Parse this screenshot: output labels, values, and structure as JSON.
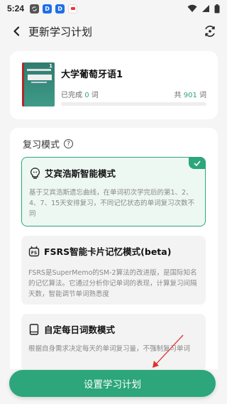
{
  "status_bar": {
    "time": "5:24",
    "notif_d1": "D",
    "notif_d2": "D"
  },
  "header": {
    "title": "更新学习计划"
  },
  "book": {
    "title": "大学葡萄牙语1",
    "completed_prefix": "已完成",
    "completed_count": "0",
    "completed_suffix": "词",
    "total_prefix": "共",
    "total_count": "901",
    "total_suffix": "词",
    "progress": 0,
    "cover_number": "1"
  },
  "review": {
    "section_title": "复习模式",
    "help_icon_glyph": "?",
    "modes": [
      {
        "title": "艾宾浩斯智能模式",
        "description": "基于艾宾浩斯遗忘曲线，在单词初次学完后的第1、2、4、7、15天安排复习，不同记忆状态的单词复习次数不同",
        "selected": true,
        "icon": "lightbulb-icon"
      },
      {
        "title": "FSRS智能卡片记忆模式(beta)",
        "description": "FSRS是SuperMemo的SM-2算法的改进版，是国际知名的记忆算法。它通过分析你记单词的表现，计算复习间隔天数，智能调节单词熟悉度",
        "selected": false,
        "icon": "fsrs-robot-icon"
      },
      {
        "title": "自定每日词数模式",
        "description": "根据自身需求决定每天的单词复习量，不强制复习单词",
        "selected": false,
        "icon": "book-icon"
      }
    ]
  },
  "bottom_button": {
    "label": "设置学习计划"
  },
  "colors": {
    "accent": "#2ca67a",
    "background": "#f5f5f5"
  }
}
